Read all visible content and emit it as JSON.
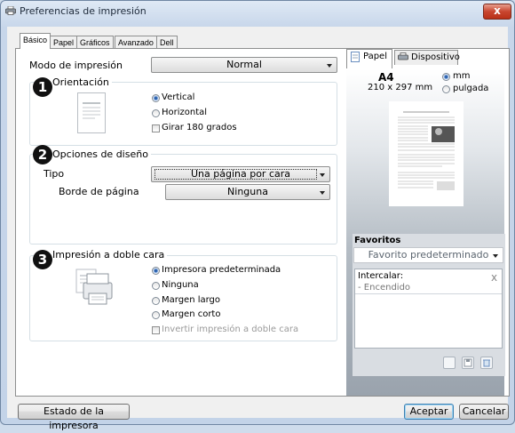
{
  "window": {
    "title": "Preferencias de impresión",
    "close_glyph": "x"
  },
  "tabs": [
    {
      "label": "Básico",
      "active": true
    },
    {
      "label": "Papel",
      "active": false
    },
    {
      "label": "Gráficos",
      "active": false
    },
    {
      "label": "Avanzado",
      "active": false
    },
    {
      "label": "Dell",
      "active": false
    }
  ],
  "print_mode": {
    "label": "Modo de impresión",
    "value": "Normal"
  },
  "orientation": {
    "title": "Orientación",
    "badge": "1",
    "options": [
      {
        "label": "Vertical",
        "selected": true
      },
      {
        "label": "Horizontal",
        "selected": false
      }
    ],
    "rotate": {
      "label": "Girar 180 grados",
      "checked": false
    }
  },
  "layout": {
    "title": "Opciones de diseño",
    "badge": "2",
    "type_label": "Tipo",
    "type_value": "Una página por cara",
    "border_label": "Borde de página",
    "border_value": "Ninguna"
  },
  "duplex": {
    "title": "Impresión a doble cara",
    "badge": "3",
    "options": [
      {
        "label": "Impresora predeterminada",
        "selected": true
      },
      {
        "label": "Ninguna",
        "selected": false
      },
      {
        "label": "Margen largo",
        "selected": false
      },
      {
        "label": "Margen corto",
        "selected": false
      }
    ],
    "invert": {
      "label": "Invertir impresión a doble cara",
      "checked": false,
      "disabled": true
    }
  },
  "preview": {
    "tab_paper": "Papel",
    "tab_device": "Dispositivo",
    "paper_size": "A4",
    "paper_dims": "210 x 297 mm",
    "units": [
      {
        "label": "mm",
        "selected": true
      },
      {
        "label": "pulgada",
        "selected": false
      }
    ]
  },
  "favorites": {
    "title": "Favoritos",
    "selected": "Favorito predeterminado",
    "settings_title": "Intercalar:",
    "settings_value": "Encendido",
    "remove_glyph": "x"
  },
  "footer": {
    "status_button": "Estado de la impresora",
    "accept_button": "Aceptar",
    "cancel_button": "Cancelar"
  },
  "colors": {
    "accent": "#2a5ea8",
    "close": "#c8462f",
    "frame": "#c7d6ea"
  }
}
